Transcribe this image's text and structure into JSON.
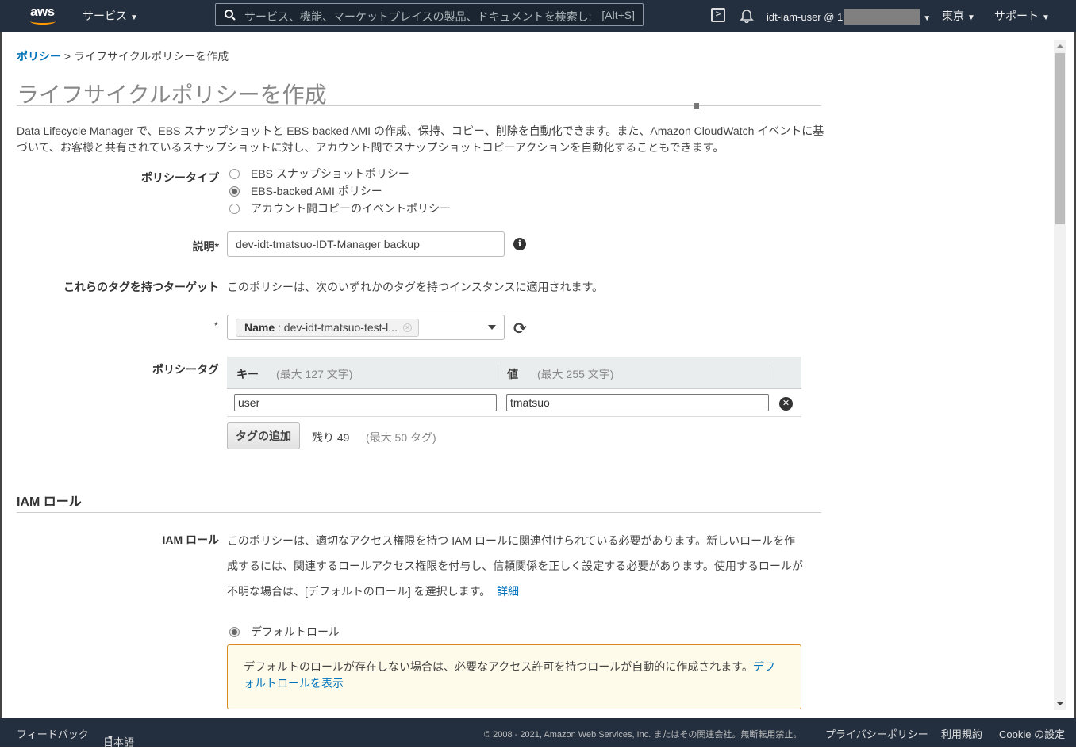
{
  "topnav": {
    "logo": "aws",
    "services_label": "サービス",
    "search_placeholder": "サービス、機能、マーケットプレイスの製品、ドキュメントを検索し:",
    "search_hotkey": "[Alt+S]",
    "cloudshell_icon": "cloudshell-icon",
    "bell_icon": "bell-icon",
    "user_label": "idt-iam-user @ 1",
    "region_label": "東京",
    "support_label": "サポート"
  },
  "breadcrumb": {
    "parent": "ポリシー",
    "separator": ">",
    "current": "ライフサイクルポリシーを作成"
  },
  "page": {
    "title": "ライフサイクルポリシーを作成",
    "intro": "Data Lifecycle Manager で、EBS スナップショットと EBS-backed AMI の作成、保持、コピー、削除を自動化できます。また、Amazon CloudWatch イベントに基づいて、お客様と共有されているスナップショットに対し、アカウント間でスナップショットコピーアクションを自動化することもできます。"
  },
  "policy_type": {
    "label": "ポリシータイプ",
    "options": [
      {
        "label": "EBS スナップショットポリシー",
        "selected": false
      },
      {
        "label": "EBS-backed AMI ポリシー",
        "selected": true
      },
      {
        "label": "アカウント間コピーのイベントポリシー",
        "selected": false
      }
    ]
  },
  "description": {
    "label": "説明*",
    "value": "dev-idt-tmatsuo-IDT-Manager backup"
  },
  "target_tags": {
    "label": "これらのタグを持つターゲット",
    "help": "このポリシーは、次のいずれかのタグを持つインスタンスに適用されます。",
    "required_mark": "*",
    "chip_key": "Name",
    "chip_value": " : dev-idt-tmatsuo-test-l..."
  },
  "policy_tags": {
    "label": "ポリシータグ",
    "key_header": "キー",
    "key_hint": "(最大 127 文字)",
    "value_header": "値",
    "value_hint": "(最大 255 文字)",
    "rows": [
      {
        "key": "user",
        "value": "tmatsuo"
      }
    ],
    "add_button": "タグの追加",
    "remaining": "残り 49",
    "max_hint": "(最大 50 タグ)"
  },
  "iam": {
    "section_title": "IAM ロール",
    "label": "IAM ロール",
    "description": "このポリシーは、適切なアクセス権限を持つ IAM ロールに関連付けられている必要があります。新しいロールを作成するには、関連するロールアクセス権限を付与し、信頼関係を正しく設定する必要があります。使用するロールが不明な場合は、[デフォルトのロール] を選択します。",
    "details_link": "詳細",
    "default_role_option": "デフォルトロール",
    "default_role_selected": true,
    "notice_text": "デフォルトのロールが存在しない場合は、必要なアクセス許可を持つロールが自動的に作成されます。",
    "notice_link": "デフォルトロールを表示"
  },
  "footer": {
    "feedback": "フィードバック",
    "language": "日本語",
    "copyright": "© 2008 - 2021, Amazon Web Services, Inc. またはその関連会社。無断転用禁止。",
    "privacy": "プライバシーポリシー",
    "terms": "利用規約",
    "cookie": "Cookie の設定"
  },
  "colors": {
    "nav_bg": "#232f3e",
    "link": "#0073bb",
    "aws_orange": "#ff9900",
    "notice_border": "#d98a1e",
    "notice_bg": "#fffbea"
  }
}
